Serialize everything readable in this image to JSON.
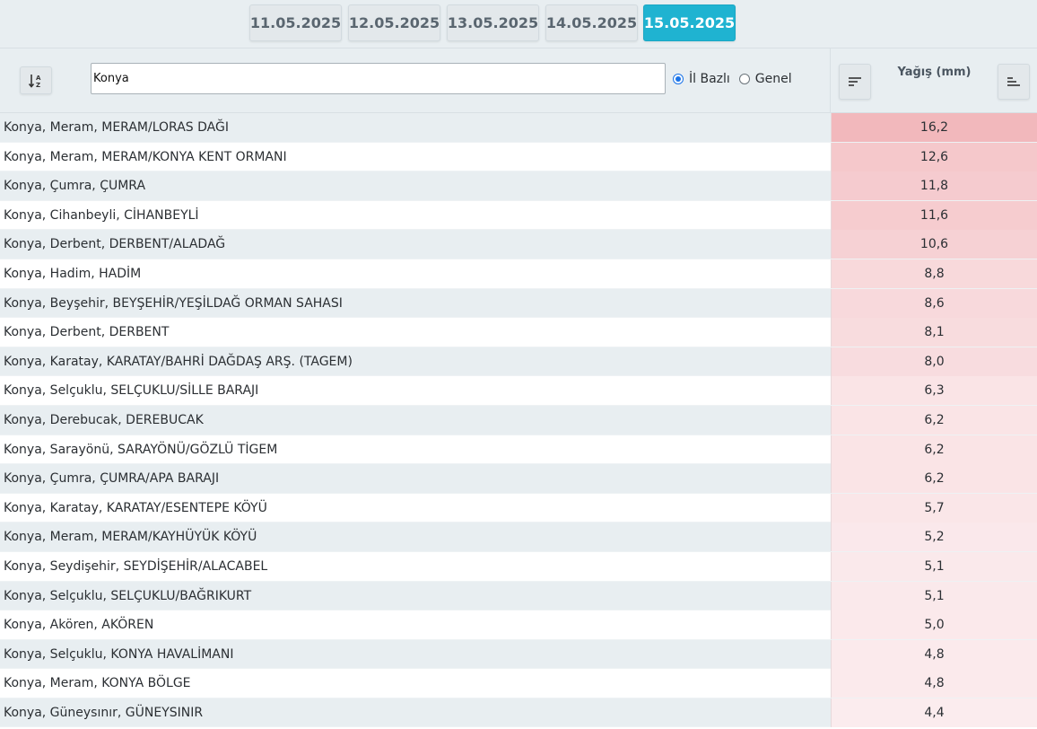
{
  "dates": {
    "tabs": [
      "11.05.2025",
      "12.05.2025",
      "13.05.2025",
      "14.05.2025",
      "15.05.2025"
    ],
    "active": "15.05.2025"
  },
  "toolbar": {
    "search_value": "Konya",
    "radio_il_label": "İl Bazlı",
    "radio_genel_label": "Genel",
    "selected_radio": "İl Bazlı",
    "column_title": "Yağış (mm)"
  },
  "colors": {
    "accent": "#1fb3d1",
    "value_high": "#f2b8bc",
    "value_low": "#fbecee"
  },
  "stations": [
    {
      "name": "Konya, Meram, MERAM/LORAS DAĞI",
      "value": "16,2"
    },
    {
      "name": "Konya, Meram, MERAM/KONYA KENT ORMANI",
      "value": "12,6"
    },
    {
      "name": "Konya, Çumra, ÇUMRA",
      "value": "11,8"
    },
    {
      "name": "Konya, Cihanbeyli, CİHANBEYLİ",
      "value": "11,6"
    },
    {
      "name": "Konya, Derbent, DERBENT/ALADAĞ",
      "value": "10,6"
    },
    {
      "name": "Konya, Hadim, HADİM",
      "value": "8,8"
    },
    {
      "name": "Konya, Beyşehir, BEYŞEHİR/YEŞİLDAĞ ORMAN SAHASI",
      "value": "8,6"
    },
    {
      "name": "Konya, Derbent, DERBENT",
      "value": "8,1"
    },
    {
      "name": "Konya, Karatay, KARATAY/BAHRİ DAĞDAŞ ARŞ. (TAGEM)",
      "value": "8,0"
    },
    {
      "name": "Konya, Selçuklu, SELÇUKLU/SİLLE BARAJI",
      "value": "6,3"
    },
    {
      "name": "Konya, Derebucak, DEREBUCAK",
      "value": "6,2"
    },
    {
      "name": "Konya, Sarayönü, SARAYÖNÜ/GÖZLÜ TİGEM",
      "value": "6,2"
    },
    {
      "name": "Konya, Çumra, ÇUMRA/APA BARAJI",
      "value": "6,2"
    },
    {
      "name": "Konya, Karatay, KARATAY/ESENTEPE KÖYÜ",
      "value": "5,7"
    },
    {
      "name": "Konya, Meram, MERAM/KAYHÜYÜK KÖYÜ",
      "value": "5,2"
    },
    {
      "name": "Konya, Seydişehir, SEYDİŞEHİR/ALACABEL",
      "value": "5,1"
    },
    {
      "name": "Konya, Selçuklu, SELÇUKLU/BAĞRIKURT",
      "value": "5,1"
    },
    {
      "name": "Konya, Akören, AKÖREN",
      "value": "5,0"
    },
    {
      "name": "Konya, Selçuklu, KONYA HAVALİMANI",
      "value": "4,8"
    },
    {
      "name": "Konya, Meram, KONYA BÖLGE",
      "value": "4,8"
    },
    {
      "name": "Konya, Güneysınır, GÜNEYSINIR",
      "value": "4,4"
    }
  ]
}
